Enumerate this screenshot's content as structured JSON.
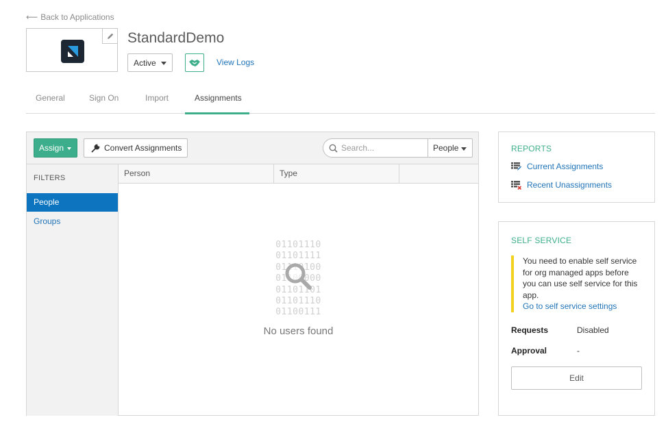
{
  "nav": {
    "back_label": "Back to Applications"
  },
  "app": {
    "title": "StandardDemo",
    "status": "Active",
    "view_logs": "View Logs"
  },
  "tabs": [
    {
      "label": "General",
      "active": false
    },
    {
      "label": "Sign On",
      "active": false
    },
    {
      "label": "Import",
      "active": false
    },
    {
      "label": "Assignments",
      "active": true
    }
  ],
  "toolbar": {
    "assign_label": "Assign",
    "convert_label": "Convert Assignments",
    "search_placeholder": "Search...",
    "search_scope": "People"
  },
  "filters": {
    "title": "FILTERS",
    "items": [
      {
        "label": "People",
        "selected": true
      },
      {
        "label": "Groups",
        "selected": false
      }
    ]
  },
  "table": {
    "columns": [
      "Person",
      "Type",
      ""
    ],
    "rows": [],
    "empty_message": "No users found",
    "binary_lines": [
      "01101110",
      "01101111",
      "01110100",
      "01100000",
      "01101101",
      "01101110",
      "01100111"
    ]
  },
  "reports": {
    "title": "REPORTS",
    "links": [
      {
        "label": "Current Assignments",
        "icon": "report-grid-icon"
      },
      {
        "label": "Recent Unassignments",
        "icon": "report-remove-icon"
      }
    ]
  },
  "self_service": {
    "title": "SELF SERVICE",
    "notice": "You need to enable self service for org managed apps before you can use self service for this app.",
    "notice_link": "Go to self service settings",
    "requests_label": "Requests",
    "requests_value": "Disabled",
    "approval_label": "Approval",
    "approval_value": "-",
    "edit_label": "Edit"
  },
  "colors": {
    "accent_green": "#3dae8b",
    "link_blue": "#1f73b7",
    "selected_blue": "#0d75c0",
    "notice_yellow": "#f2d21e"
  }
}
